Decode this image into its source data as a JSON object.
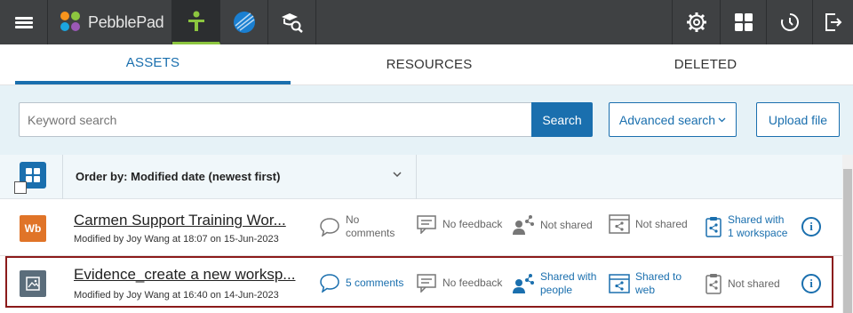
{
  "app": {
    "brand": "PebblePad"
  },
  "colors": {
    "topbar": "#3f4143",
    "accent": "#1a6fae",
    "active_indicator": "#8cc63f",
    "selected_border": "#8b1a1a",
    "wb_badge": "#e07428",
    "evidence_badge": "#5b6d7b"
  },
  "topbar": {
    "icons": [
      "menu-icon",
      "pebblepad-logo",
      "asset-store-icon",
      "atlas-icon",
      "resource-search-icon",
      "settings-icon",
      "dashboard-icon",
      "history-icon",
      "logout-icon"
    ]
  },
  "tabs": [
    {
      "label": "ASSETS",
      "active": true
    },
    {
      "label": "RESOURCES",
      "active": false
    },
    {
      "label": "DELETED",
      "active": false
    }
  ],
  "search": {
    "placeholder": "Keyword search",
    "button": "Search",
    "advanced": "Advanced search",
    "upload": "Upload file"
  },
  "order": {
    "label": "Order by: Modified date (newest first)"
  },
  "rows": [
    {
      "badge": "Wb",
      "title": "Carmen Support Training Wor...",
      "modified": "Modified by Joy Wang at 18:07 on 15-Jun-2023",
      "comments": [
        "No",
        "comments"
      ],
      "feedback": "No feedback",
      "shared_people": "Not shared",
      "shared_web": "Not shared",
      "workspace": [
        "Shared with",
        "1 workspace"
      ]
    },
    {
      "badge": "",
      "title": "Evidence_create a new worksp...",
      "modified": "Modified by Joy Wang at 16:40 on 14-Jun-2023",
      "comments": [
        "5 comments"
      ],
      "feedback": "No feedback",
      "shared_people": [
        "Shared with",
        "people"
      ],
      "shared_web": [
        "Shared to",
        "web"
      ],
      "workspace": "Not shared"
    }
  ]
}
